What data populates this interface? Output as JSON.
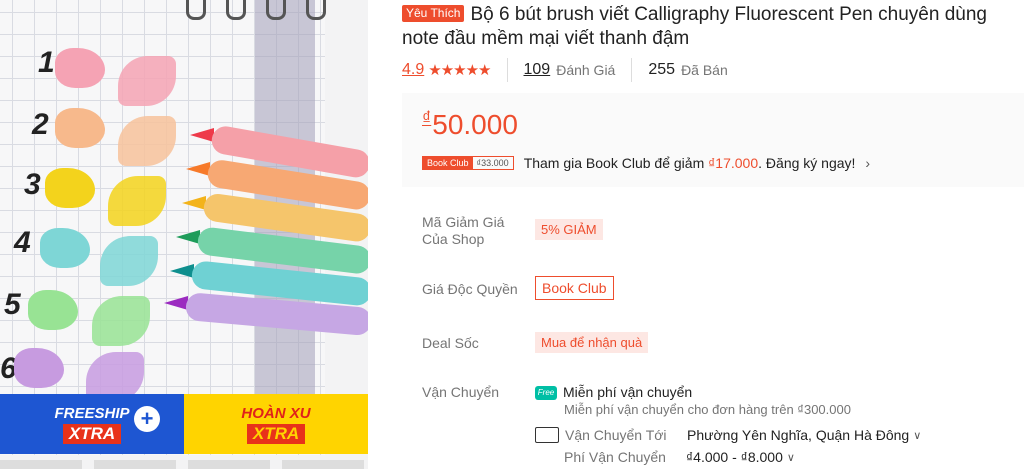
{
  "product_image": {
    "numbers": [
      "1",
      "2",
      "3",
      "4",
      "5",
      "6"
    ],
    "colors": [
      "#f5a3b4",
      "#f7b98c",
      "#f3d31c",
      "#7ed6d6",
      "#98e394",
      "#c79be0"
    ],
    "pen_colors": [
      "#f5a0a8",
      "#f7a873",
      "#f5c56b",
      "#76d3a9",
      "#6fd1d3",
      "#c6a7e4"
    ],
    "promo": {
      "freeship": "FREESHIP",
      "freeship_sub": "XTRA",
      "plus": "+",
      "hoanxu": "HOÀN XU",
      "hoanxu_sub": "XTRA"
    }
  },
  "product": {
    "badge": "Yêu Thích",
    "title": "Bộ 6 bút brush viết Calligraphy Fluorescent Pen chuyên dùng note đầu mềm mại viết thanh đậm",
    "rating": "4.9",
    "stars": "★★★★★",
    "reviews_count": "109",
    "reviews_label": "Đánh Giá",
    "sold_count": "255",
    "sold_label": "Đã Bán"
  },
  "price": {
    "currency": "₫",
    "value": "50.000",
    "bookclub_tag": "Book Club",
    "bookclub_price": "₫33.000",
    "bookclub_text_pre": "Tham gia Book Club để giảm ",
    "bookclub_discount": "₫17.000",
    "bookclub_text_post": ". Đăng ký ngay!",
    "chevron": "›"
  },
  "details": {
    "voucher_label": "Mã Giảm Giá Của Shop",
    "voucher_value": "5% GIẢM",
    "exclusive_label": "Giá Độc Quyền",
    "exclusive_value": "Book Club",
    "deal_label": "Deal Sốc",
    "deal_value": "Mua để nhận quà",
    "shipping_label": "Vận Chuyển",
    "free_ship_icon": "Free",
    "free_ship": "Miễn phí vận chuyển",
    "free_ship_desc": "Miễn phí vận chuyển cho đơn hàng trên ₫300.000",
    "ship_to_label": "Vận Chuyển Tới",
    "ship_to_value": "Phường Yên Nghĩa, Quận Hà Đông",
    "ship_fee_label": "Phí Vận Chuyển",
    "ship_fee_value": "₫4.000 - ₫8.000"
  }
}
